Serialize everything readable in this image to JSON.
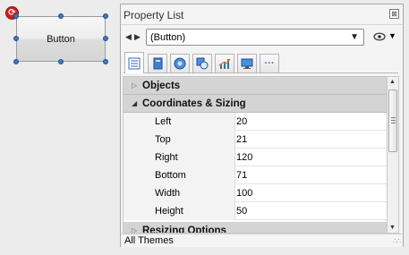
{
  "canvas": {
    "button_label": "Button"
  },
  "panel": {
    "title": "Property List",
    "close_glyph": "⊠",
    "nav": {
      "back": "◀",
      "forward": "▶"
    },
    "selector": {
      "value": "(Button)",
      "caret": "▼"
    },
    "visibility_caret": "▼",
    "tabs": [
      {
        "icon": "properties-list-icon"
      },
      {
        "icon": "book-icon"
      },
      {
        "icon": "globe-icon"
      },
      {
        "icon": "shapes-icon"
      },
      {
        "icon": "chart-icon"
      },
      {
        "icon": "monitor-icon"
      },
      {
        "label": "···"
      }
    ],
    "categories": {
      "objects": "Objects",
      "coordinates": "Coordinates & Sizing",
      "resizing": "Resizing Options"
    },
    "properties": [
      {
        "name": "Left",
        "value": "20"
      },
      {
        "name": "Top",
        "value": "21"
      },
      {
        "name": "Right",
        "value": "120"
      },
      {
        "name": "Bottom",
        "value": "71"
      },
      {
        "name": "Width",
        "value": "100"
      },
      {
        "name": "Height",
        "value": "50"
      }
    ],
    "status": "All Themes"
  },
  "colors": {
    "category_bg": "#d4d4d4",
    "handle": "#3a78c8",
    "badge": "#d21f1f"
  }
}
